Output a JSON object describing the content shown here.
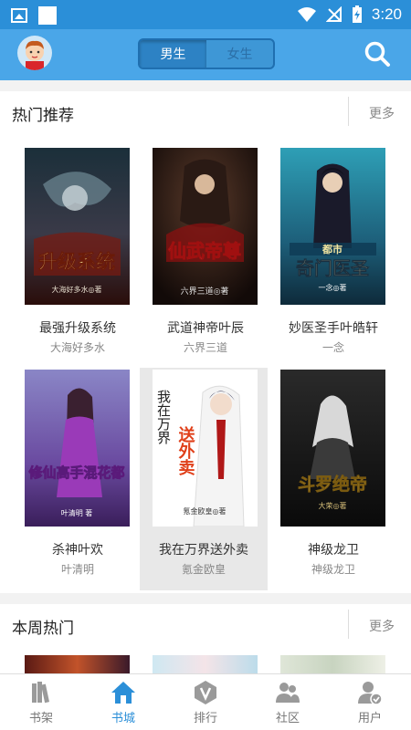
{
  "status_bar": {
    "time": "3:20"
  },
  "header": {
    "tabs": [
      {
        "label": "男生",
        "active": true
      },
      {
        "label": "女生",
        "active": false
      }
    ],
    "accent_color": "#4aa6e8"
  },
  "hot_recommend": {
    "title": "热门推荐",
    "more": "更多",
    "books": [
      {
        "title": "最强升级系统",
        "author": "大海好多水",
        "cover_text": "升级系统",
        "cover_sub": "大海好多水◎著"
      },
      {
        "title": "武道神帝叶辰",
        "author": "六界三道",
        "cover_text": "仙武帝尊",
        "cover_sub": "六界三道◎著"
      },
      {
        "title": "妙医圣手叶皓轩",
        "author": "一念",
        "cover_top": "都市",
        "cover_text": "奇门医圣",
        "cover_sub": "一念◎著"
      },
      {
        "title": "杀神叶欢",
        "author": "叶清明",
        "cover_text": "修仙高手混花都",
        "cover_sub": "叶清明 著"
      },
      {
        "title": "我在万界送外卖",
        "author": "氪金欧皇",
        "cover_text_1": "我在万界",
        "cover_text_2": "送外卖",
        "cover_sub": "氪金欧皇◎著",
        "selected": true
      },
      {
        "title": "神级龙卫",
        "author": "神级龙卫",
        "cover_text": "斗罗绝帝",
        "cover_sub": "大荣◎著"
      }
    ]
  },
  "weekly_hot": {
    "title": "本周热门",
    "more": "更多"
  },
  "tabbar": {
    "items": [
      {
        "label": "书架",
        "icon": "bookshelf-icon",
        "active": false
      },
      {
        "label": "书城",
        "icon": "home-icon",
        "active": true
      },
      {
        "label": "排行",
        "icon": "ranking-icon",
        "active": false
      },
      {
        "label": "社区",
        "icon": "community-icon",
        "active": false
      },
      {
        "label": "用户",
        "icon": "user-icon",
        "active": false
      }
    ]
  }
}
